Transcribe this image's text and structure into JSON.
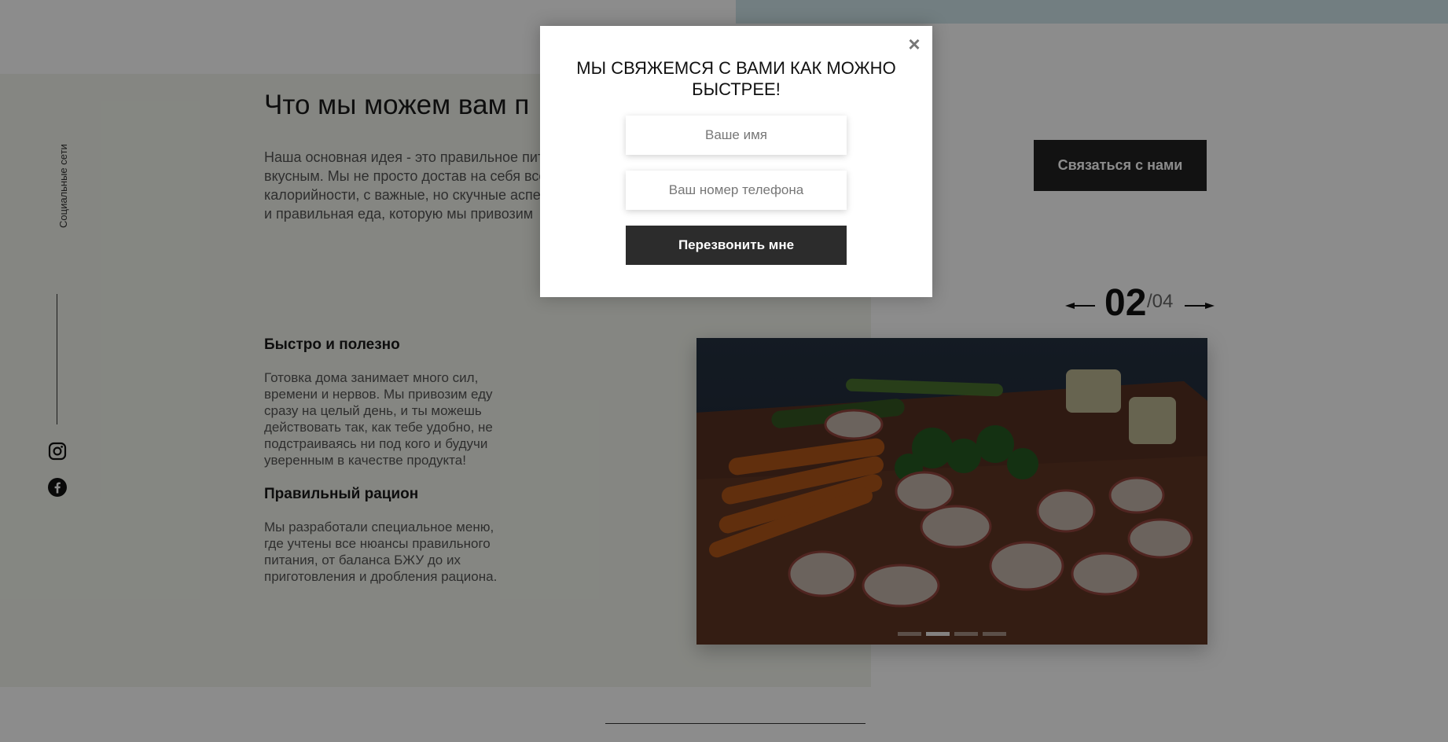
{
  "sidebar": {
    "social_label": "Социальные сети",
    "icons": [
      "instagram-icon",
      "facebook-icon"
    ]
  },
  "main": {
    "section_title": "Что мы можем вам п",
    "intro_text": "Наша основная идея - это правильное пит простым и вкусным. Мы не просто достав на себя все расчеты БЖУ, калорийности, с важные, но скучные аспекты. Вам остаетс и правильная еда, которую мы привозим",
    "contact_button_label": "Связаться с нами",
    "features": [
      {
        "heading": "Быстро и полезно",
        "text": "Готовка дома занимает много сил, времени и нервов. Мы привозим еду сразу на целый день, и ты можешь действовать так, как тебе удобно, не подстраиваясь ни под кого и будучи уверенным в качестве продукта!"
      },
      {
        "heading": "Правильный рацион",
        "text": "Мы разработали специальное меню, где учтены все нюансы правильного питания, от баланса БЖУ до их приготовления и дробления рациона."
      }
    ]
  },
  "slider": {
    "current": "02",
    "total": "/04",
    "dot_count": 4,
    "active_dot": 2,
    "image_icon": "vegetables-photo"
  },
  "modal": {
    "title": "МЫ СВЯЖЕМСЯ С ВАМИ КАК МОЖНО БЫСТРЕЕ!",
    "close_symbol": "×",
    "name_placeholder": "Ваше имя",
    "phone_placeholder": "Ваш номер телефона",
    "callback_button_label": "Перезвонить мне"
  },
  "colors": {
    "accent_dark": "#222222",
    "overlay": "rgba(0,0,0,0.45)",
    "beige_bg": "#f3f5ed",
    "top_strip": "#cfe6ec"
  }
}
